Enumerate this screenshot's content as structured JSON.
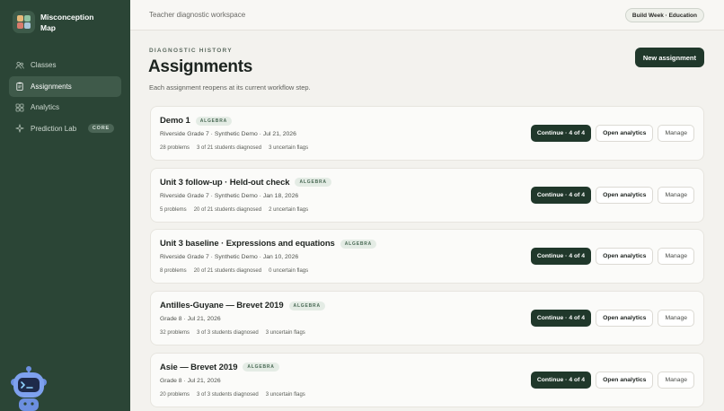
{
  "brand": {
    "line1": "Misconception",
    "line2": "Map"
  },
  "nav": [
    {
      "label": "Classes",
      "icon": "users-icon",
      "active": false
    },
    {
      "label": "Assignments",
      "icon": "clipboard-icon",
      "active": true
    },
    {
      "label": "Analytics",
      "icon": "grid-icon",
      "active": false
    },
    {
      "label": "Prediction Lab",
      "icon": "sparkle-icon",
      "active": false,
      "badge": "CORE"
    }
  ],
  "topbar": {
    "title": "Teacher diagnostic workspace",
    "pill": "Build Week · Education"
  },
  "header": {
    "eyebrow": "DIAGNOSTIC HISTORY",
    "title": "Assignments",
    "subtitle": "Each assignment reopens at its current workflow step.",
    "new_button": "New assignment"
  },
  "assignments": [
    {
      "title": "Demo 1",
      "tag": "ALGEBRA",
      "meta": "Riverside Grade 7 · Synthetic Demo · Jul 21, 2026",
      "problems": "28 problems",
      "diagnosed": "3 of 21 students diagnosed",
      "flags": "3 uncertain flags",
      "continue": "Continue · 4 of 4",
      "analytics": "Open analytics",
      "manage": "Manage"
    },
    {
      "title": "Unit 3 follow-up · Held-out check",
      "tag": "ALGEBRA",
      "meta": "Riverside Grade 7 · Synthetic Demo · Jan 18, 2026",
      "problems": "5 problems",
      "diagnosed": "20 of 21 students diagnosed",
      "flags": "2 uncertain flags",
      "continue": "Continue · 4 of 4",
      "analytics": "Open analytics",
      "manage": "Manage"
    },
    {
      "title": "Unit 3 baseline · Expressions and equations",
      "tag": "ALGEBRA",
      "meta": "Riverside Grade 7 · Synthetic Demo · Jan 10, 2026",
      "problems": "8 problems",
      "diagnosed": "20 of 21 students diagnosed",
      "flags": "0 uncertain flags",
      "continue": "Continue · 4 of 4",
      "analytics": "Open analytics",
      "manage": "Manage"
    },
    {
      "title": "Antilles-Guyane — Brevet 2019",
      "tag": "ALGEBRA",
      "meta": "Grade 8 · Jul 21, 2026",
      "problems": "32 problems",
      "diagnosed": "3 of 3 students diagnosed",
      "flags": "3 uncertain flags",
      "continue": "Continue · 4 of 4",
      "analytics": "Open analytics",
      "manage": "Manage"
    },
    {
      "title": "Asie — Brevet 2019",
      "tag": "ALGEBRA",
      "meta": "Grade 8 · Jul 21, 2026",
      "problems": "20 problems",
      "diagnosed": "3 of 3 students diagnosed",
      "flags": "3 uncertain flags",
      "continue": "Continue · 4 of 4",
      "analytics": "Open analytics",
      "manage": "Manage"
    }
  ],
  "mascot": {
    "icon": "robot-mascot-icon"
  },
  "colors": {
    "sidebar": "#2b4536",
    "primary": "#20382b",
    "background": "#f3f2ee"
  }
}
